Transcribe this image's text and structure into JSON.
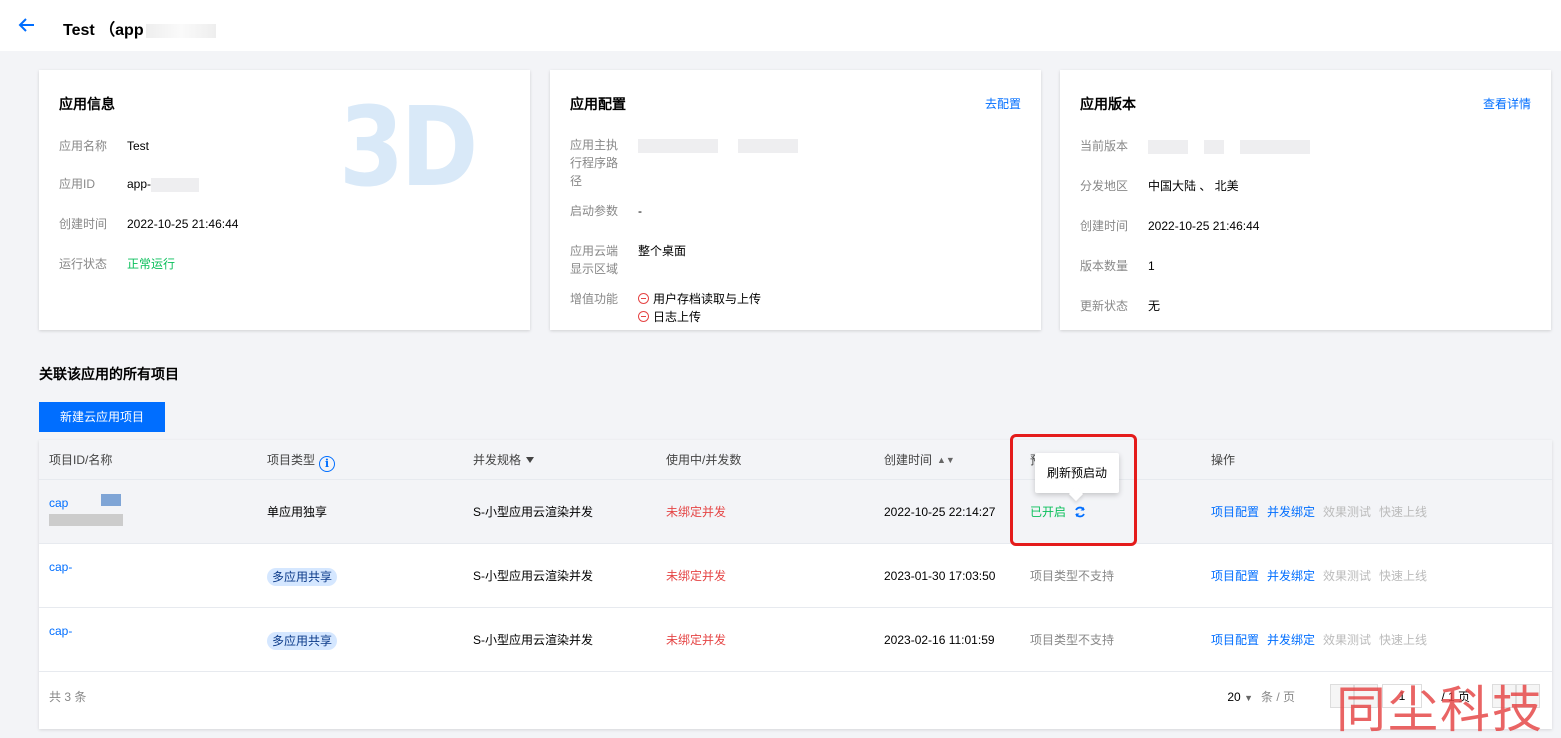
{
  "header": {
    "title": "Test （app"
  },
  "app_info": {
    "title": "应用信息",
    "logo_text": "3D",
    "rows": [
      {
        "k": "应用名称",
        "v": "Test"
      },
      {
        "k": "应用ID",
        "v": "app-"
      },
      {
        "k": "创建时间",
        "v": "2022-10-25 21:46:44"
      },
      {
        "k": "运行状态",
        "v": "正常运行"
      }
    ]
  },
  "app_config": {
    "title": "应用配置",
    "link": "去配置",
    "rows": [
      {
        "k": "应用主执行程序路径",
        "v": ""
      },
      {
        "k": "启动参数",
        "v": "-"
      },
      {
        "k": "应用云端显示区域",
        "v": "整个桌面"
      },
      {
        "k": "增值功能",
        "v1": "用户存档读取与上传",
        "v2": "日志上传"
      }
    ]
  },
  "app_version": {
    "title": "应用版本",
    "link": "查看详情",
    "rows": [
      {
        "k": "当前版本",
        "v": ""
      },
      {
        "k": "分发地区",
        "v": "中国大陆 、 北美"
      },
      {
        "k": "创建时间",
        "v": "2022-10-25 21:46:44"
      },
      {
        "k": "版本数量",
        "v": "1"
      },
      {
        "k": "更新状态",
        "v": "无"
      }
    ]
  },
  "projects": {
    "section_title": "关联该应用的所有项目",
    "new_button": "新建云应用项目",
    "columns": [
      "项目ID/名称",
      "项目类型",
      "并发规格",
      "使用中/并发数",
      "创建时间",
      "预",
      "操作"
    ],
    "rows": [
      {
        "id": "cap",
        "type": "单应用独享",
        "spec": "S-小型应用云渲染并发",
        "usage": "未绑定并发",
        "created": "2022-10-25 22:14:27",
        "prestart": "已开启",
        "ops": [
          "项目配置",
          "并发绑定",
          "效果测试",
          "快速上线"
        ]
      },
      {
        "id": "cap-",
        "type": "多应用共享",
        "spec": "S-小型应用云渲染并发",
        "usage": "未绑定并发",
        "created": "2023-01-30 17:03:50",
        "prestart": "项目类型不支持",
        "ops": [
          "项目配置",
          "并发绑定",
          "效果测试",
          "快速上线"
        ]
      },
      {
        "id": "cap-",
        "type": "多应用共享",
        "spec": "S-小型应用云渲染并发",
        "usage": "未绑定并发",
        "created": "2023-02-16 11:01:59",
        "prestart": "项目类型不支持",
        "ops": [
          "项目配置",
          "并发绑定",
          "效果测试",
          "快速上线"
        ]
      }
    ],
    "tooltip": "刷新预启动",
    "total": "共 3 条",
    "page_size": "20",
    "page_size_unit": "条 / 页",
    "page_input": "1",
    "page_total": "/ 1 页"
  },
  "watermark": "同尘科技",
  "colors": {
    "accent": "#006eff",
    "success": "#0abf5b",
    "danger": "#e54545",
    "highlight_box": "#e41b1b"
  }
}
